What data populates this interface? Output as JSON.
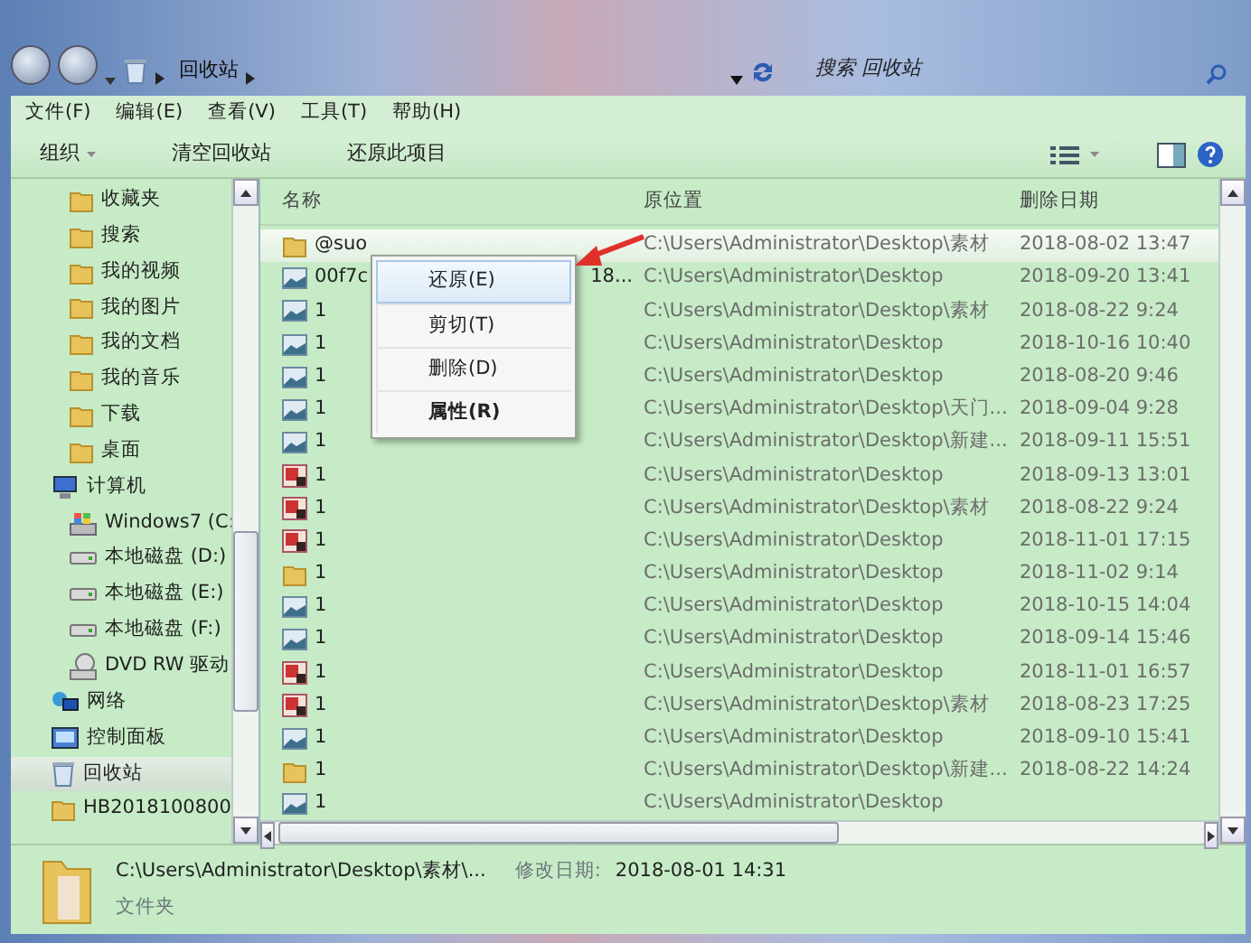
{
  "address_bar": {
    "location": "回收站",
    "search_placeholder": "搜索 回收站"
  },
  "menu_bar": [
    "文件(F)",
    "编辑(E)",
    "查看(V)",
    "工具(T)",
    "帮助(H)"
  ],
  "toolbar": {
    "organize": "组织",
    "buttons": [
      "清空回收站",
      "还原此项目"
    ]
  },
  "sidebar": {
    "scrolled_group_children": [
      {
        "label": "收藏夹",
        "kind": "folder",
        "selected": false
      },
      {
        "label": "搜索",
        "kind": "folder",
        "selected": false
      },
      {
        "label": "我的视频",
        "kind": "folder",
        "selected": false
      },
      {
        "label": "我的图片",
        "kind": "folder",
        "selected": false
      },
      {
        "label": "我的文档",
        "kind": "folder",
        "selected": false
      },
      {
        "label": "我的音乐",
        "kind": "folder",
        "selected": false
      },
      {
        "label": "下载",
        "kind": "folder",
        "selected": false
      },
      {
        "label": "桌面",
        "kind": "folder",
        "selected": false
      }
    ],
    "items": [
      {
        "label": "计算机",
        "kind": "computer",
        "selected": false,
        "children": [
          {
            "label": "Windows7 (C:",
            "kind": "system-drive",
            "selected": false
          },
          {
            "label": "本地磁盘 (D:)",
            "kind": "drive",
            "selected": false
          },
          {
            "label": "本地磁盘 (E:)",
            "kind": "drive",
            "selected": false
          },
          {
            "label": "本地磁盘 (F:)",
            "kind": "drive",
            "selected": false
          },
          {
            "label": "DVD RW 驱动",
            "kind": "dvd",
            "selected": false
          }
        ]
      },
      {
        "label": "网络",
        "kind": "network",
        "selected": false
      },
      {
        "label": "控制面板",
        "kind": "panel",
        "selected": false
      },
      {
        "label": "回收站",
        "kind": "recycle",
        "selected": true
      },
      {
        "label": "HB2018100800",
        "kind": "folder",
        "selected": false
      }
    ]
  },
  "table": {
    "columns": [
      "名称",
      "原位置",
      "删除日期"
    ],
    "rows": [
      {
        "kind": "folder",
        "name": "@suo",
        "location": "C:\\Users\\Administrator\\Desktop\\素材",
        "date": "2018-08-02 13:47",
        "selected": true
      },
      {
        "kind": "image",
        "name": "00f7c",
        "name_end": "18...",
        "location": "C:\\Users\\Administrator\\Desktop",
        "date": "2018-09-20 13:41",
        "selected": false
      },
      {
        "kind": "image",
        "name": "1",
        "location": "C:\\Users\\Administrator\\Desktop\\素材",
        "date": "2018-08-22 9:24",
        "selected": false
      },
      {
        "kind": "image",
        "name": "1",
        "location": "C:\\Users\\Administrator\\Desktop",
        "date": "2018-10-16 10:40",
        "selected": false
      },
      {
        "kind": "image",
        "name": "1",
        "location": "C:\\Users\\Administrator\\Desktop",
        "date": "2018-08-20 9:46",
        "selected": false
      },
      {
        "kind": "image",
        "name": "1",
        "location": "C:\\Users\\Administrator\\Desktop\\天门...",
        "date": "2018-09-04 9:28",
        "selected": false
      },
      {
        "kind": "image",
        "name": "1",
        "location": "C:\\Users\\Administrator\\Desktop\\新建...",
        "date": "2018-09-11 15:51",
        "selected": false
      },
      {
        "kind": "slides",
        "name": "1",
        "location": "C:\\Users\\Administrator\\Desktop",
        "date": "2018-09-13 13:01",
        "selected": false
      },
      {
        "kind": "slides",
        "name": "1",
        "location": "C:\\Users\\Administrator\\Desktop\\素材",
        "date": "2018-08-22 9:24",
        "selected": false
      },
      {
        "kind": "slides",
        "name": "1",
        "location": "C:\\Users\\Administrator\\Desktop",
        "date": "2018-11-01 17:15",
        "selected": false
      },
      {
        "kind": "folder",
        "name": "1",
        "location": "C:\\Users\\Administrator\\Desktop",
        "date": "2018-11-02 9:14",
        "selected": false
      },
      {
        "kind": "image",
        "name": "1",
        "location": "C:\\Users\\Administrator\\Desktop",
        "date": "2018-10-15 14:04",
        "selected": false
      },
      {
        "kind": "image",
        "name": "1",
        "location": "C:\\Users\\Administrator\\Desktop",
        "date": "2018-09-14 15:46",
        "selected": false
      },
      {
        "kind": "slides",
        "name": "1",
        "location": "C:\\Users\\Administrator\\Desktop",
        "date": "2018-11-01 16:57",
        "selected": false
      },
      {
        "kind": "slides",
        "name": "1",
        "location": "C:\\Users\\Administrator\\Desktop\\素材",
        "date": "2018-08-23 17:25",
        "selected": false
      },
      {
        "kind": "image",
        "name": "1",
        "location": "C:\\Users\\Administrator\\Desktop",
        "date": "2018-09-10 15:41",
        "selected": false
      },
      {
        "kind": "folder",
        "name": "1",
        "location": "C:\\Users\\Administrator\\Desktop\\新建...",
        "date": "2018-08-22 14:24",
        "selected": false
      },
      {
        "kind": "image",
        "name": "1",
        "location": "C:\\Users\\Administrator\\Desktop",
        "selected": false
      }
    ]
  },
  "context_menu": [
    {
      "label": "还原(E)",
      "selected": true,
      "default": false
    },
    {
      "label": "剪切(T)",
      "selected": false,
      "default": false
    },
    {
      "label": "删除(D)",
      "selected": false,
      "default": false
    },
    {
      "label": "属性(R)",
      "selected": false,
      "default": true
    }
  ],
  "details_pane": {
    "path": "C:\\Users\\Administrator\\Desktop\\素材\\...",
    "modified_label": "修改日期:",
    "modified": "2018-08-01 14:31",
    "type": "文件夹"
  }
}
